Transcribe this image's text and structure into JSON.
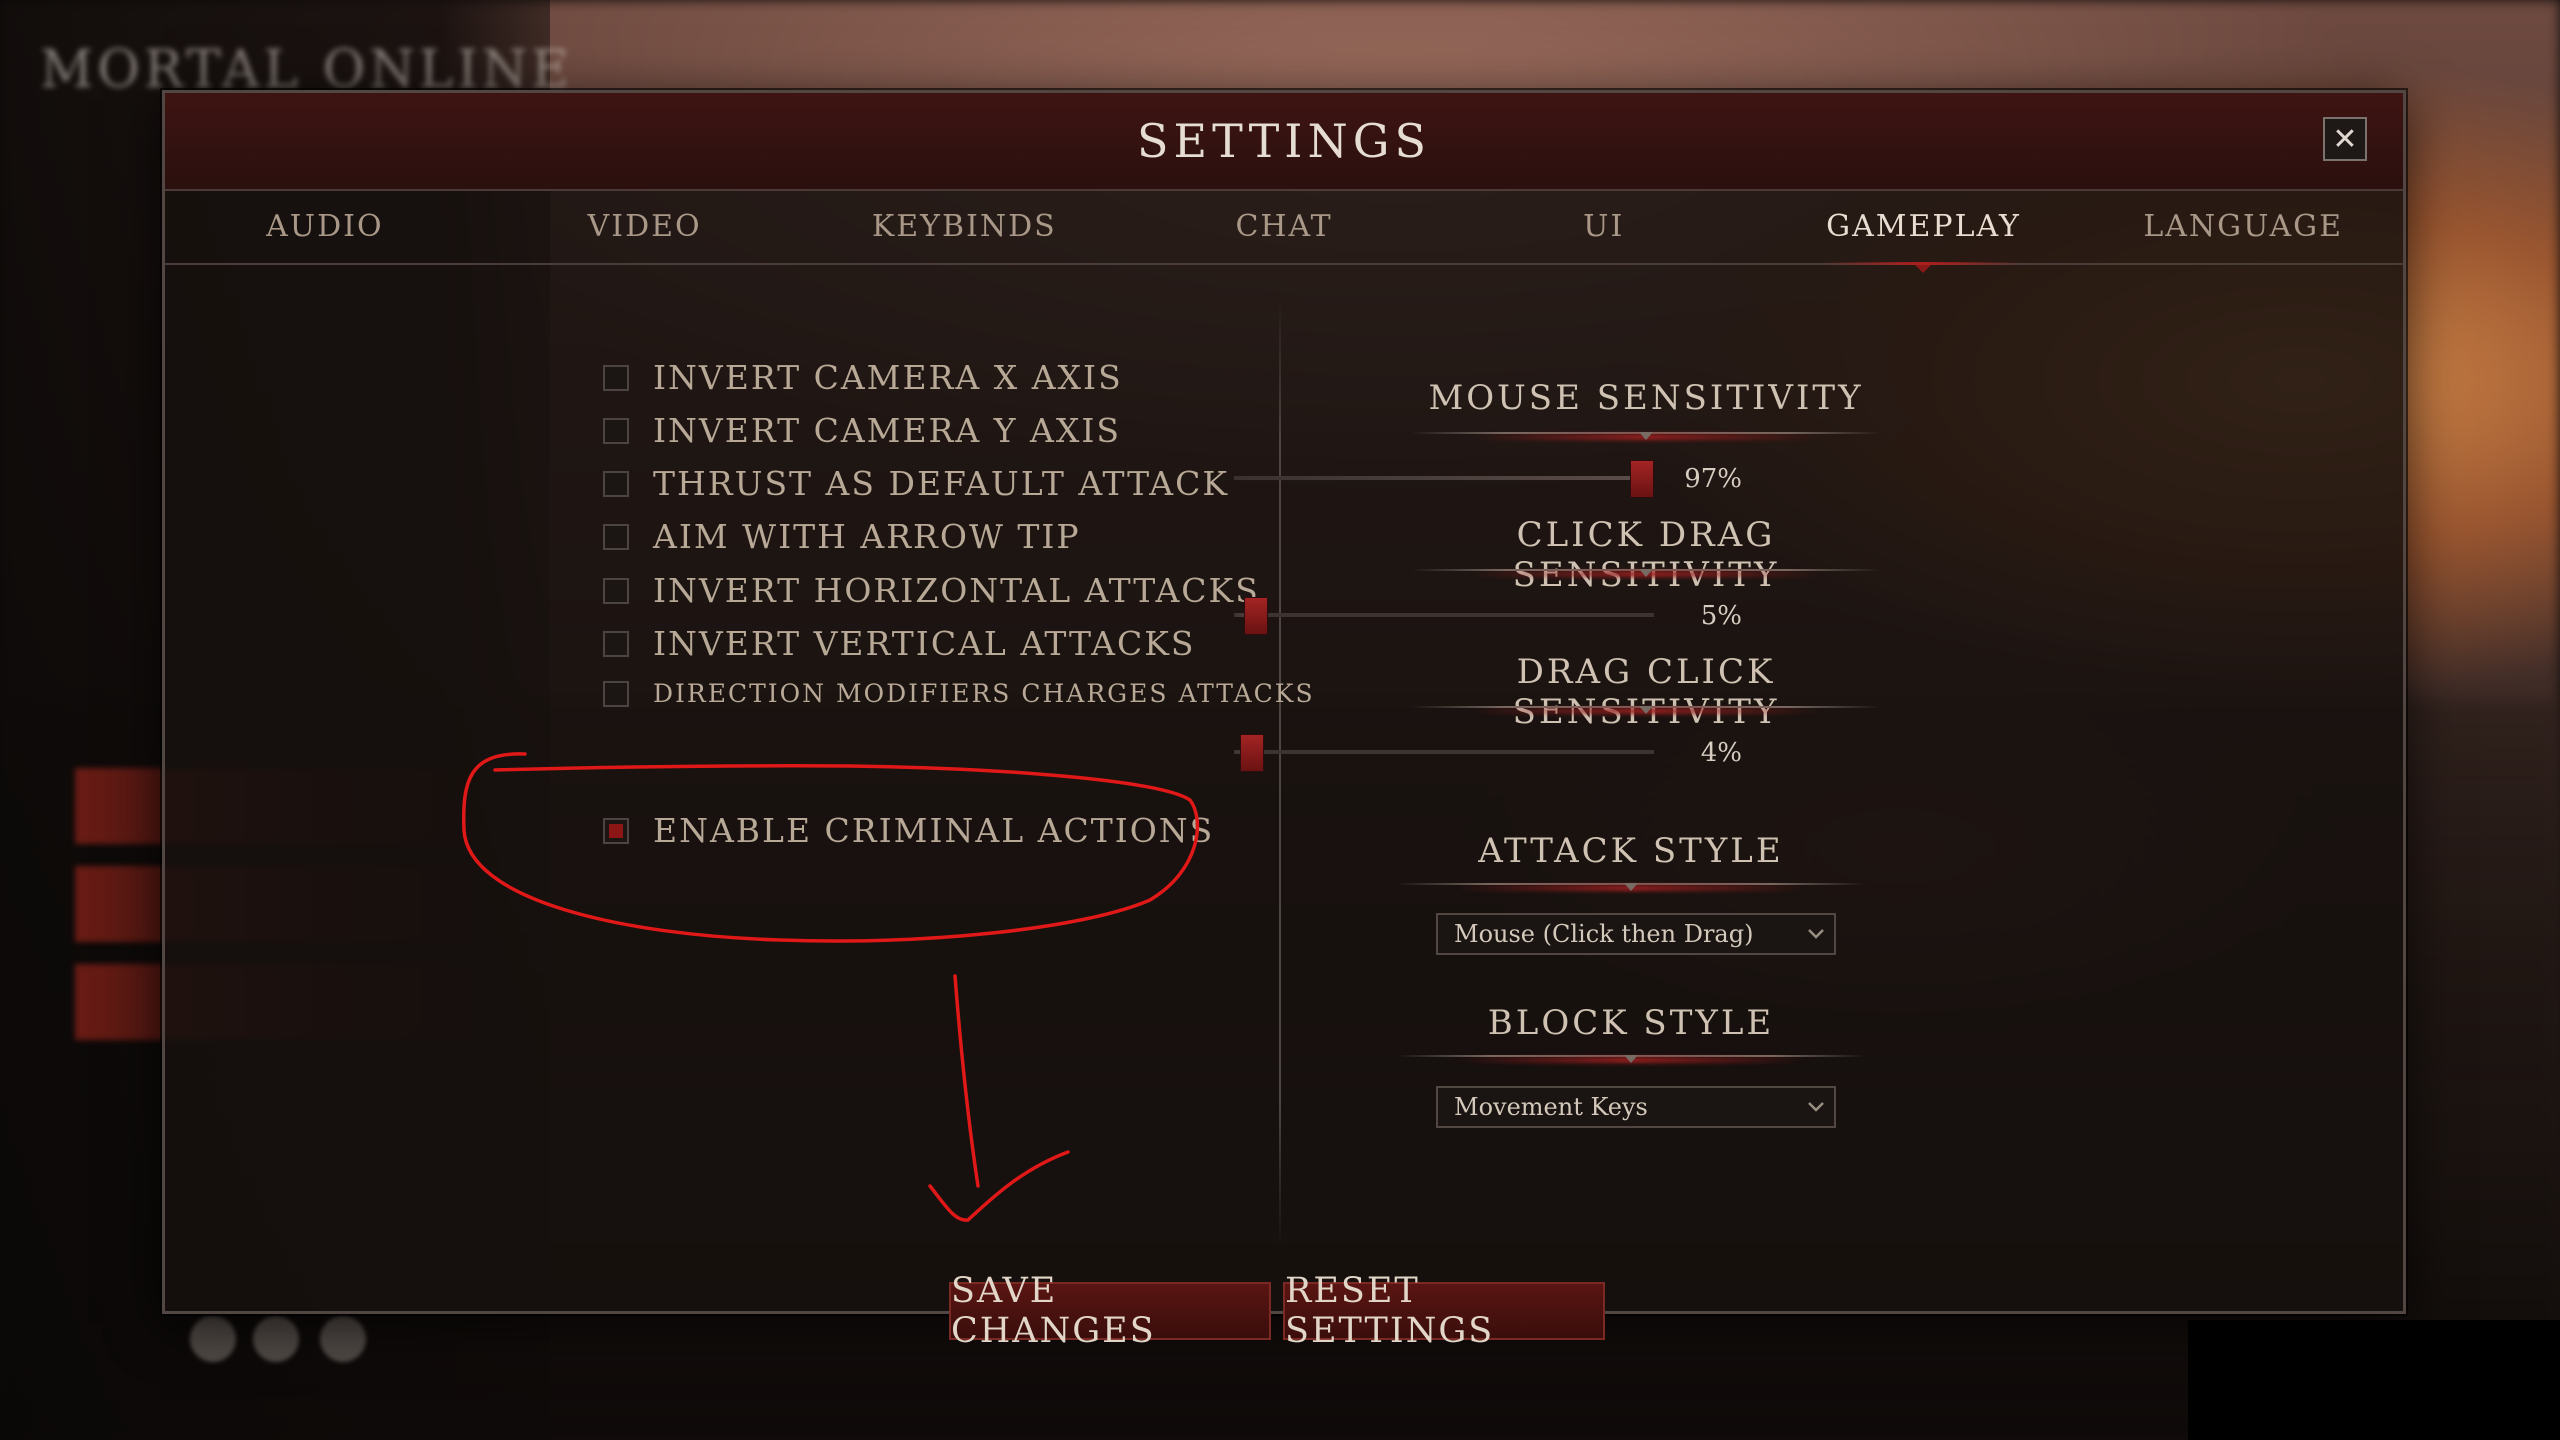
{
  "background": {
    "logo_text": "MORTAL ONLINE"
  },
  "dialog": {
    "title": "SETTINGS",
    "close_icon": "close-icon",
    "tabs": [
      {
        "label": "AUDIO",
        "active": false
      },
      {
        "label": "VIDEO",
        "active": false
      },
      {
        "label": "KEYBINDS",
        "active": false
      },
      {
        "label": "CHAT",
        "active": false
      },
      {
        "label": "UI",
        "active": false
      },
      {
        "label": "GAMEPLAY",
        "active": true
      },
      {
        "label": "LANGUAGE",
        "active": false
      }
    ]
  },
  "gameplay": {
    "options": [
      {
        "label": "INVERT CAMERA X AXIS",
        "checked": false
      },
      {
        "label": "INVERT CAMERA Y AXIS",
        "checked": false
      },
      {
        "label": "THRUST AS DEFAULT ATTACK",
        "checked": false
      },
      {
        "label": "AIM WITH ARROW TIP",
        "checked": false
      },
      {
        "label": "INVERT HORIZONTAL ATTACKS",
        "checked": false
      },
      {
        "label": "INVERT VERTICAL ATTACKS",
        "checked": false
      },
      {
        "label": "DIRECTION MODIFIERS CHARGES ATTACKS",
        "checked": false
      },
      {
        "label": "ENABLE CRIMINAL ACTIONS",
        "checked": true
      }
    ],
    "sliders": [
      {
        "title": "MOUSE SENSITIVITY",
        "value_label": "97%",
        "value": 0.97
      },
      {
        "title": "CLICK DRAG SENSITIVITY",
        "value_label": "5%",
        "value": 0.05
      },
      {
        "title": "DRAG CLICK SENSITIVITY",
        "value_label": "4%",
        "value": 0.04
      }
    ],
    "attack_style": {
      "title": "ATTACK STYLE",
      "selected": "Mouse (Click then Drag)"
    },
    "block_style": {
      "title": "BLOCK STYLE",
      "selected": "Movement Keys"
    }
  },
  "actions": {
    "save_label": "SAVE CHANGES",
    "reset_label": "RESET SETTINGS"
  },
  "colors": {
    "accent_red": "#8c1616",
    "annotation_red": "#e01818",
    "text": "#c9b9a4"
  }
}
